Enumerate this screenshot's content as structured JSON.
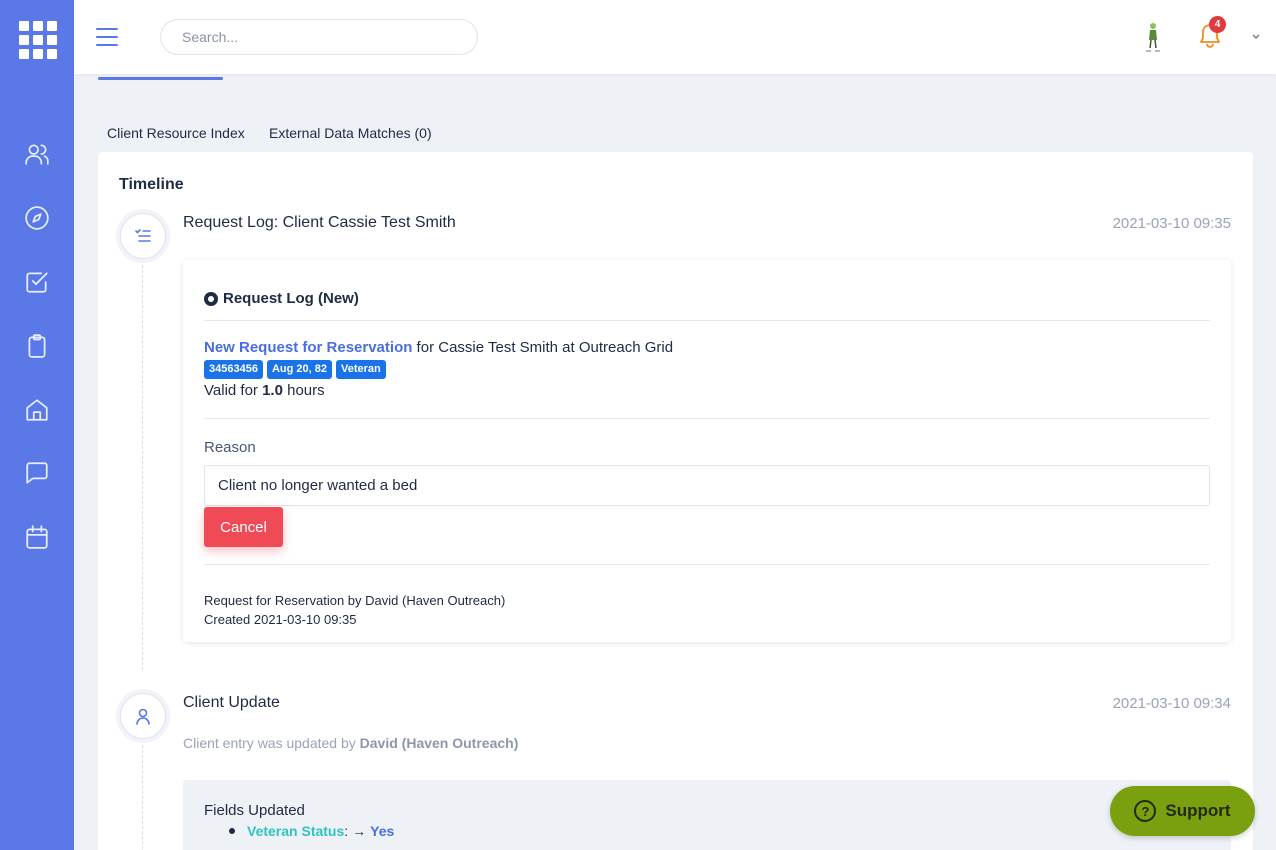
{
  "topbar": {
    "search_placeholder": "Search...",
    "notification_count": "4"
  },
  "tabs": [
    {
      "label": "Client Resource Index"
    },
    {
      "label": "External Data Matches (0)"
    }
  ],
  "timeline": {
    "title": "Timeline",
    "items": [
      {
        "icon": "checklist-icon",
        "title": "Request Log: Client Cassie Test Smith",
        "time": "2021-03-10 09:35",
        "status_label": "Request Log (New)",
        "request_link": "New Request for Reservation",
        "request_rest": " for Cassie Test Smith at Outreach Grid",
        "chips": [
          "34563456",
          "Aug 20, 82",
          "Veteran"
        ],
        "valid_prefix": "Valid for ",
        "valid_value": "1.0",
        "valid_suffix": " hours",
        "reason_label": "Reason",
        "reason_value": "Client no longer wanted a bed",
        "cancel_label": "Cancel",
        "meta_by": "Request for Reservation by David (Haven Outreach)",
        "meta_created": "Created 2021-03-10 09:35"
      },
      {
        "icon": "user-icon",
        "title": "Client Update",
        "time": "2021-03-10 09:34",
        "sub_prefix": "Client entry was updated by ",
        "sub_author": "David (Haven Outreach)",
        "fields_title": "Fields Updated",
        "field_name": "Veteran Status",
        "field_sep": " : ",
        "field_arrow": "→",
        "field_value": "Yes"
      }
    ]
  },
  "support": {
    "label": "Support"
  },
  "colors": {
    "sidebar": "#5a78e6",
    "link": "#4a6ee0",
    "chip": "#1a73e8",
    "cancel": "#ef4a55",
    "support": "#7aa010"
  }
}
